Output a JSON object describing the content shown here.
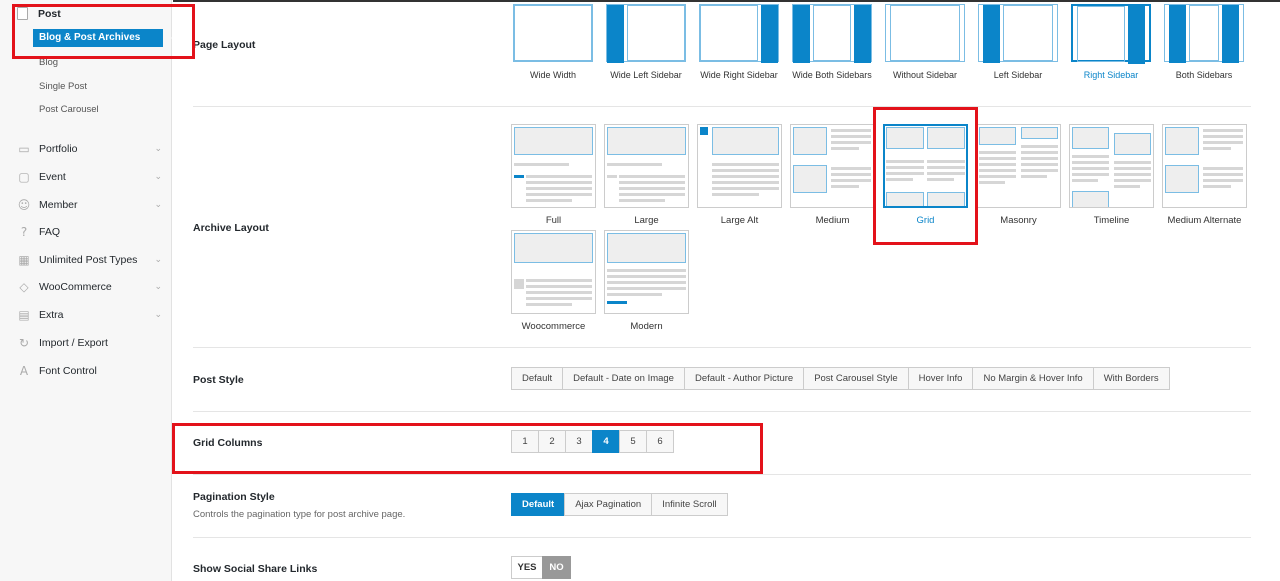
{
  "sidebar": {
    "top_item": "Post",
    "active_item": "Blog & Post Archives",
    "sub_items": [
      "Blog",
      "Single Post",
      "Post Carousel"
    ],
    "items": [
      {
        "label": "Portfolio",
        "icon": "image-icon",
        "glyph": "▭",
        "expandable": true
      },
      {
        "label": "Event",
        "icon": "calendar-icon",
        "glyph": "▢",
        "expandable": true
      },
      {
        "label": "Member",
        "icon": "user-icon",
        "glyph": "☺",
        "expandable": true
      },
      {
        "label": "FAQ",
        "icon": "question-icon",
        "glyph": "?",
        "expandable": false
      },
      {
        "label": "Unlimited Post Types",
        "icon": "grid-icon",
        "glyph": "▦",
        "expandable": true
      },
      {
        "label": "WooCommerce",
        "icon": "woo-icon",
        "glyph": "◇",
        "expandable": true
      },
      {
        "label": "Extra",
        "icon": "stack-icon",
        "glyph": "▤",
        "expandable": true
      },
      {
        "label": "Import / Export",
        "icon": "refresh-icon",
        "glyph": "↻",
        "expandable": false
      },
      {
        "label": "Font Control",
        "icon": "font-icon",
        "glyph": "A",
        "expandable": false
      }
    ]
  },
  "page_layout": {
    "label": "Page Layout",
    "options": [
      "Wide Width",
      "Wide Left Sidebar",
      "Wide Right Sidebar",
      "Wide Both Sidebars",
      "Without Sidebar",
      "Left Sidebar",
      "Right Sidebar",
      "Both Sidebars"
    ],
    "selected": "Right Sidebar"
  },
  "archive_layout": {
    "label": "Archive Layout",
    "options": [
      "Full",
      "Large",
      "Large Alt",
      "Medium",
      "Grid",
      "Masonry",
      "Timeline",
      "Medium Alternate",
      "Woocommerce",
      "Modern"
    ],
    "selected": "Grid"
  },
  "post_style": {
    "label": "Post Style",
    "options": [
      "Default",
      "Default - Date on Image",
      "Default - Author Picture",
      "Post Carousel Style",
      "Hover Info",
      "No Margin & Hover Info",
      "With Borders"
    ]
  },
  "grid_columns": {
    "label": "Grid Columns",
    "options": [
      "1",
      "2",
      "3",
      "4",
      "5",
      "6"
    ],
    "selected": "4"
  },
  "pagination_style": {
    "label": "Pagination Style",
    "description": "Controls the pagination type for post archive page.",
    "options": [
      "Default",
      "Ajax Pagination",
      "Infinite Scroll"
    ],
    "selected": "Default"
  },
  "social_share": {
    "label": "Show Social Share Links",
    "yes": "YES",
    "no": "NO",
    "value": "NO"
  },
  "colors": {
    "accent": "#0b85c9",
    "highlight": "#e3121a"
  }
}
